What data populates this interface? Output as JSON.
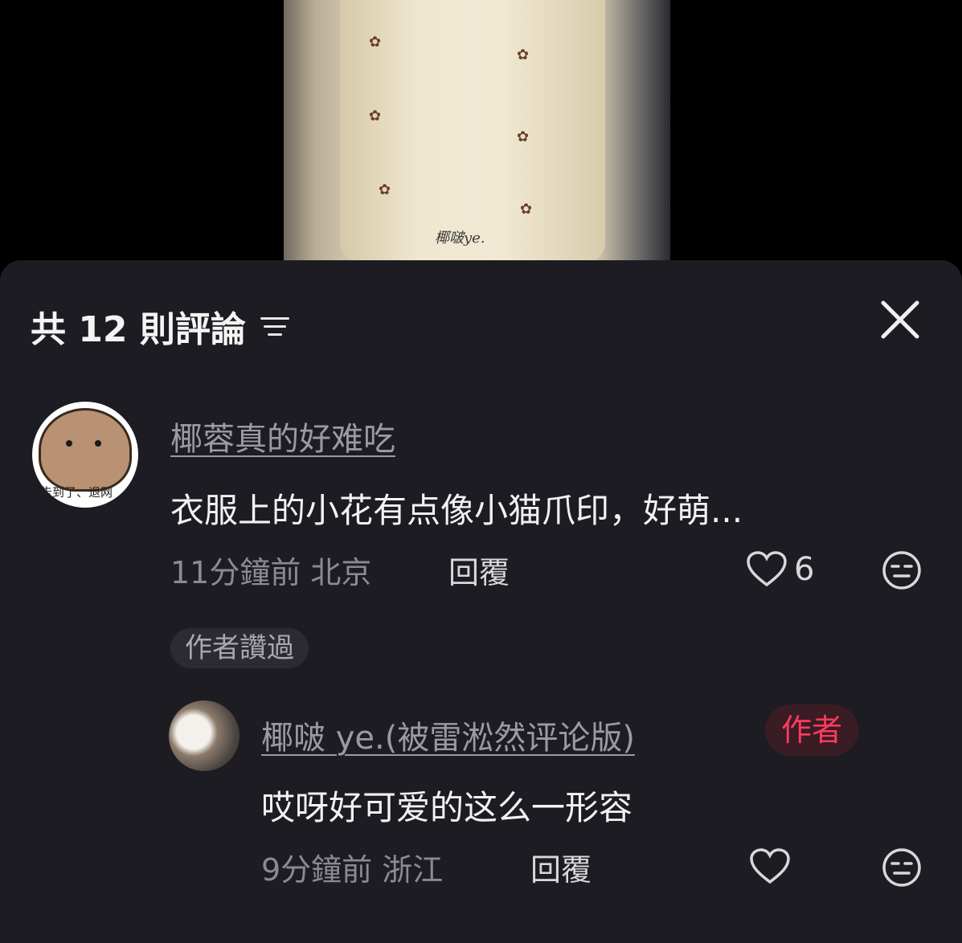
{
  "video": {
    "watermark": "椰啵ye.",
    "background_colors": [
      "#e9e2cb",
      "#6b3e2a"
    ]
  },
  "sheet": {
    "header": {
      "title": "共 12 則評論",
      "sort_icon": "sort-lines-icon",
      "close_icon": "close-x-icon"
    },
    "comments": [
      {
        "username": "椰蓉真的好难吃",
        "text": "衣服上的小花有点像小猫爪印，好萌...",
        "time_location": "11分鐘前 北京",
        "reply_label": "回覆",
        "like_count": "6",
        "like_icon": "heart-outline-icon",
        "dislike_icon": "meh-face-icon",
        "avatar_text": "告到了、退网"
      }
    ],
    "author_liked_badge": "作者讚過",
    "replies": [
      {
        "username": "椰啵 ye.(被雷淞然评论版)",
        "author_tag": "作者",
        "text": "哎呀好可爱的这么一形容",
        "time_location": "9分鐘前 浙江",
        "reply_label": "回覆",
        "like_icon": "heart-outline-icon",
        "dislike_icon": "meh-face-icon"
      }
    ]
  },
  "colors": {
    "sheet_bg": "#1d1c22",
    "author_red": "#fc3b5a",
    "muted_text": "#8a8a90"
  }
}
